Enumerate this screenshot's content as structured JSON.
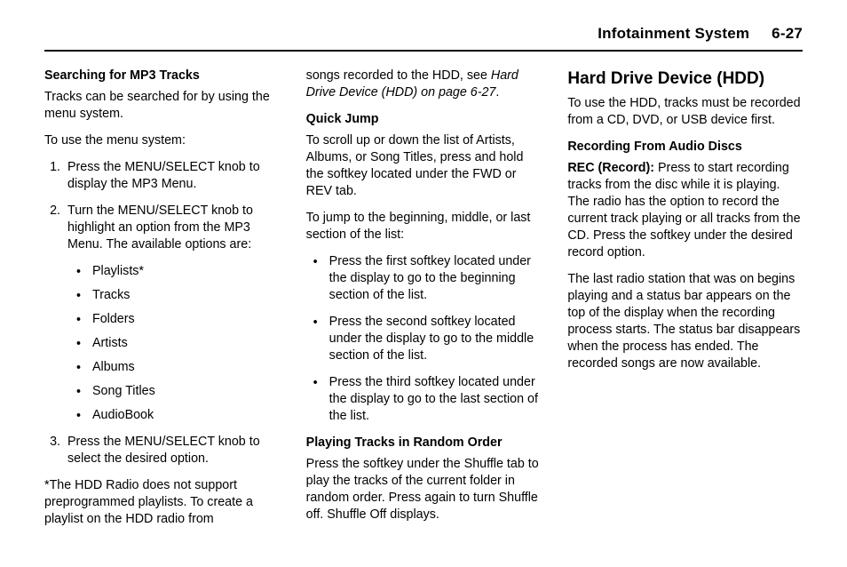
{
  "header": {
    "section_name": "Infotainment System",
    "page_num": "6-27"
  },
  "col1": {
    "h_searching": "Searching for MP3 Tracks",
    "p_tracks": "Tracks can be searched for by using the menu system.",
    "p_tousemenu": "To use the menu system:",
    "step1": "Press the MENU/SELECT knob to display the MP3 Menu.",
    "step2": "Turn the MENU/SELECT knob to highlight an option from the MP3 Menu. The available options are:",
    "opts": {
      "playlists": "Playlists*",
      "tracks": "Tracks",
      "folders": "Folders",
      "artists": "Artists",
      "albums": "Albums",
      "songtitles": "Song Titles",
      "audiobook": "AudioBook"
    },
    "step3": "Press the MENU/SELECT knob to select the desired option.",
    "p_foot_a": "*The HDD Radio does not support preprogrammed playlists. To create a playlist on the HDD radio from"
  },
  "col2": {
    "p_hdd_a": "songs recorded to the HDD, see ",
    "p_hdd_b": "Hard Drive Device (HDD) on page 6-27",
    "p_hdd_c": ".",
    "h_quick": "Quick Jump",
    "p_scroll": "To scroll up or down the list of Artists, Albums, or Song Titles, press and hold the softkey located under the FWD or REV tab.",
    "p_jump": "To jump to the beginning, middle, or last section of the list:",
    "b1": "Press the first softkey located under the display to go to the beginning section of the list.",
    "b2": "Press the second softkey located under the display to go to the middle section of the list.",
    "b3": "Press the third softkey located under the display to go to the last section of the list.",
    "h_random": "Playing Tracks in Random Order",
    "p_random": "Press the softkey under the Shuffle tab to play the tracks of the current folder in random order. Press again to turn Shuffle off. Shuffle Off displays."
  },
  "col3": {
    "h_hdd": "Hard Drive Device (HDD)",
    "p_intro": "To use the HDD, tracks must be recorded from a CD, DVD, or USB device first.",
    "h_recording": "Recording From Audio Discs",
    "rec_label": "REC (Record):",
    "rec_text": "  Press to start recording tracks from the disc while it is playing. The radio has the option to record the current track playing or all tracks from the CD. Press the softkey under the desired record option.",
    "p_last": "The last radio station that was on begins playing and a status bar appears on the top of the display when the recording process starts. The status bar disappears when the process has ended. The recorded songs are now available."
  }
}
